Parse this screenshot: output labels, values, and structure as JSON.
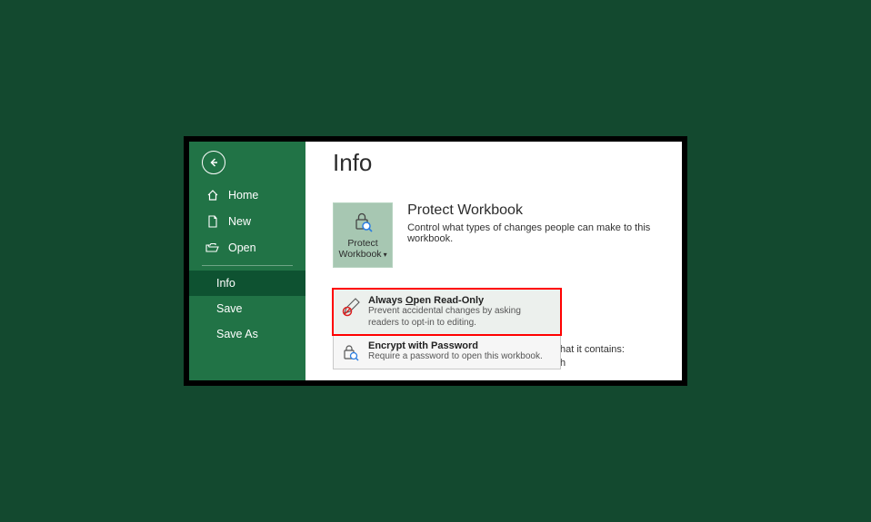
{
  "sidebar": {
    "items": [
      {
        "label": "Home"
      },
      {
        "label": "New"
      },
      {
        "label": "Open"
      },
      {
        "label": "Info"
      },
      {
        "label": "Save"
      },
      {
        "label": "Save As"
      }
    ]
  },
  "page": {
    "title": "Info"
  },
  "protect": {
    "button_line1": "Protect",
    "button_line2": "Workbook",
    "heading": "Protect Workbook",
    "description": "Control what types of changes people can make to this workbook."
  },
  "menu": {
    "read_only": {
      "title_prefix": "Always ",
      "title_underline": "O",
      "title_suffix": "pen Read-Only",
      "desc": "Prevent accidental changes by asking readers to opt-in to editing."
    },
    "encrypt": {
      "title": "Encrypt with Password",
      "desc": "Require a password to open this workbook."
    }
  },
  "bg": {
    "line1": "hat it contains:",
    "line2": "h"
  }
}
